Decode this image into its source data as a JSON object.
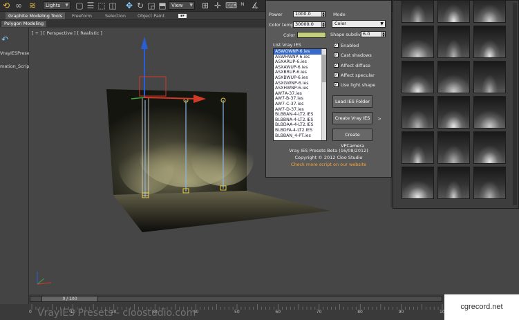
{
  "toolbar": {
    "icons": [
      "select-icon",
      "link-icon",
      "bind-icon",
      "lights-icon",
      "select-region-icon",
      "move-icon",
      "rotate-icon",
      "scale-icon",
      "view-icon"
    ],
    "filter_value": "Lights",
    "ref_coord_value": "View"
  },
  "ribbon": {
    "tabs": [
      "Graphite Modeling Tools",
      "Freeform",
      "Selection",
      "Object Paint"
    ],
    "sub_tab": "Polygon Modeling"
  },
  "left_panel": {
    "items": [
      "VrayIESPreset",
      "mation_Scrip"
    ]
  },
  "viewport": {
    "label": "[ + ] [ Perspective ] [ Realistic ]"
  },
  "dialog": {
    "power_label": "Power",
    "power_value": "1000.0",
    "color_temp_label": "Color temp",
    "color_temp_value": "30000.0",
    "color_label": "Color",
    "color_value": "#c6cf7d",
    "mode_label": "Mode",
    "mode_value": "Color",
    "shape_subdivs_label": "Shape subdivs",
    "shape_subdivs_value": "6.0",
    "checkboxes": [
      "Enabled",
      "Cast shadows",
      "Affect diffuse",
      "Affect specular",
      "Use light shape"
    ],
    "list_label": "List Vray IES",
    "ies_files": [
      "ASWGWNP-6.ies",
      "ASWHWNP-6.ies",
      "ASXARUP-6.ies",
      "ASXAWUP-6.ies",
      "ASXBRUP-6.ies",
      "ASXBWUP-6.ies",
      "ASXGWNP-6.ies",
      "ASXHWNP-6.ies",
      "AW7A-37.ies",
      "AW7-B-37.ies",
      "AW7-C-37.ies",
      "AW7-D-37.ies",
      "BLBBAN-4-LT2.IES",
      "BLBBNA-4-LT2.IES",
      "BLBDAA-4-LT2.IES",
      "BLBDFA-4-LT2.IES",
      "BLBBAN_4-PT.ies"
    ],
    "selected_index": 0,
    "buttons": [
      "Load IES Folder",
      "Create Vray IES",
      "Create VPCamera"
    ],
    "arrow_button": ">",
    "footer_title": "Vray IES Presets Beta (16/08/2012)",
    "footer_copyright": "Copyright © 2012 Cloo Studio",
    "footer_link": "Check more script on our website"
  },
  "gallery": {
    "rows": 6,
    "cols": 3
  },
  "timeline": {
    "frame_display": "0 / 100",
    "ticks": [
      "0",
      "10",
      "20",
      "30",
      "40",
      "50",
      "60",
      "70",
      "80",
      "90",
      "100"
    ],
    "watermark": "VrayIES Presets - cloostudio.com"
  },
  "brand": "cgrecord.net"
}
